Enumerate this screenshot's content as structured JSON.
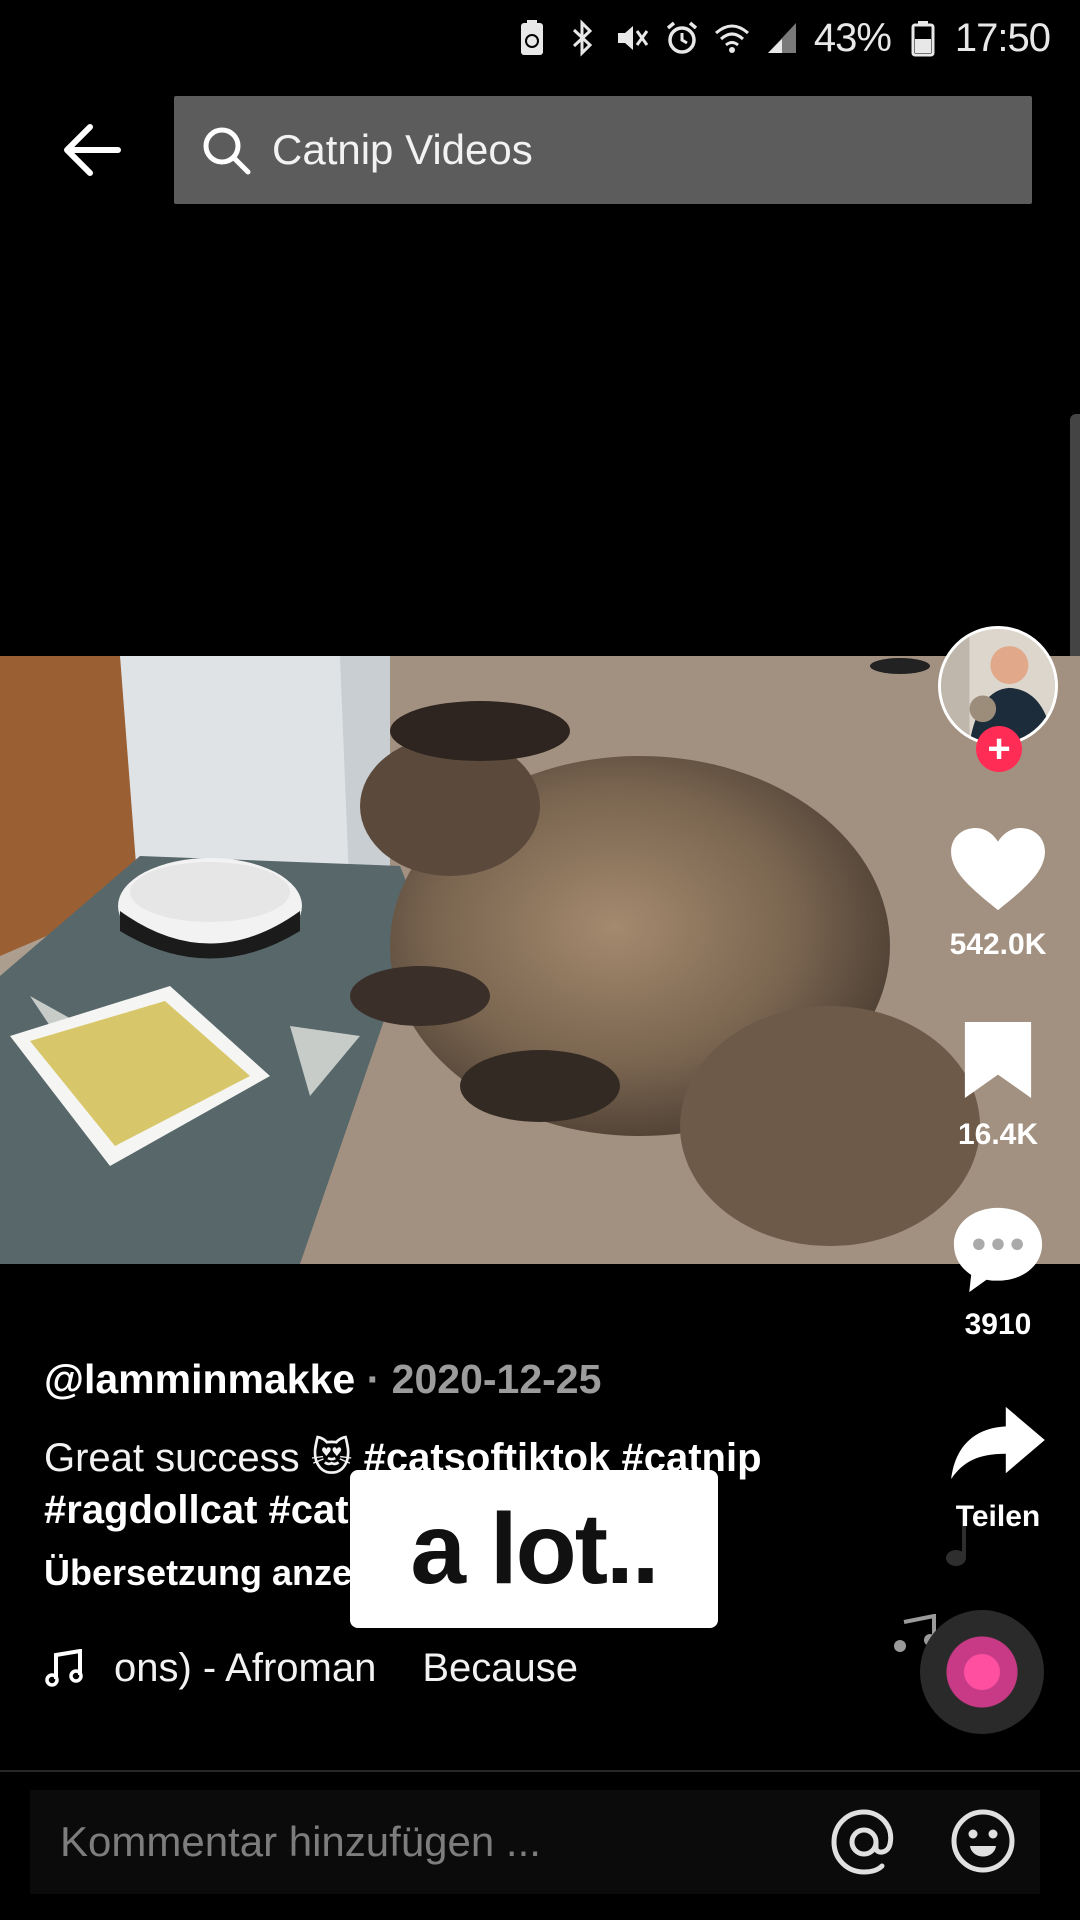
{
  "status_bar": {
    "battery_percent": "43%",
    "time": "17:50",
    "icons": [
      "battery-saver-icon",
      "bluetooth-icon",
      "mute-icon",
      "alarm-icon",
      "wifi-icon",
      "signal-icon",
      "battery-icon"
    ]
  },
  "header": {
    "back_icon": "back-arrow-icon",
    "search_value": "Catnip Videos",
    "search_icon": "search-icon"
  },
  "video": {
    "subtitle_overlay": "a lot.."
  },
  "actions": {
    "like_count": "542.0K",
    "save_count": "16.4K",
    "comment_count": "3910",
    "share_label": "Teilen",
    "follow_symbol": "+"
  },
  "post": {
    "username": "@lamminmakke",
    "separator": "·",
    "date": "2020-12-25",
    "caption_text": "Great success 😻",
    "hashtags_line1": [
      "#catsoftiktok",
      "#catnip"
    ],
    "hashtags_line2": [
      "#ragdollcat",
      "#catdad"
    ],
    "translate_label": "Übersetzung anzeigen"
  },
  "music": {
    "title_part1": "ons) - Afroman",
    "title_part2": "Because"
  },
  "comment": {
    "placeholder": "Kommentar hinzufügen ..."
  },
  "colors": {
    "background": "#000000",
    "search_bg": "#5c5c5c",
    "follow_accent": "#ff2d55",
    "muted_text": "#9c9c9c"
  }
}
